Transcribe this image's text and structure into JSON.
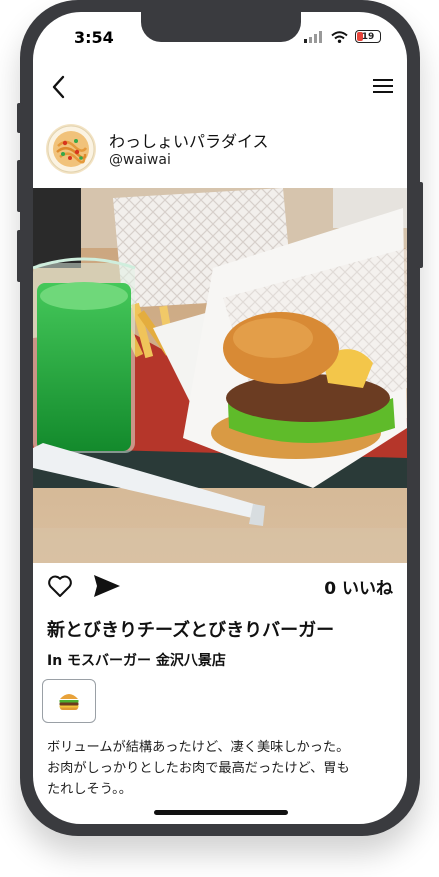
{
  "status_bar": {
    "time": "3:54",
    "battery": "19"
  },
  "nav": {
    "back_icon": "chevron-left-icon",
    "menu_icon": "hamburger-menu-icon"
  },
  "profile": {
    "name": "わっしょいパラダイス",
    "handle": "@waiwai",
    "avatar_icon": "spaghetti-icon"
  },
  "post": {
    "photo": "burger-meal-photo",
    "likes_label": "0 いいね",
    "title": "新とびきりチーズとびきりバーガー",
    "location": "In モスバーガー 金沢八景店",
    "emoji": "🍔",
    "description_lines": [
      "ボリュームが結構あったけど、凄く美味しかった。",
      "お肉がしっかりとしたお肉で最高だったけど、胃も",
      "たれしそう。。"
    ]
  },
  "colors": {
    "frame": "#3a3b3f",
    "soda": "#1fa83a",
    "battery_low": "#e8443a"
  }
}
